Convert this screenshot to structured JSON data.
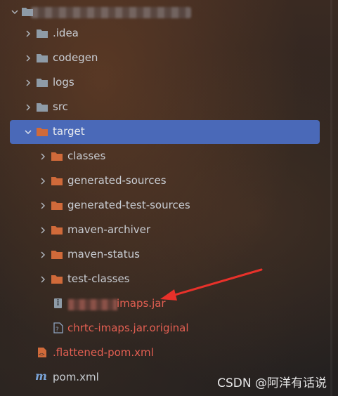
{
  "tree": {
    "items": [
      {
        "label": ".idea",
        "type": "folder",
        "expanded": false
      },
      {
        "label": "codegen",
        "type": "folder",
        "expanded": false
      },
      {
        "label": "logs",
        "type": "folder",
        "expanded": false
      },
      {
        "label": "src",
        "type": "folder",
        "expanded": false
      },
      {
        "label": "target",
        "type": "folder",
        "expanded": true,
        "selected": true
      },
      {
        "label": "classes",
        "type": "folder",
        "expanded": false
      },
      {
        "label": "generated-sources",
        "type": "folder",
        "expanded": false
      },
      {
        "label": "generated-test-sources",
        "type": "folder",
        "expanded": false
      },
      {
        "label": "maven-archiver",
        "type": "folder",
        "expanded": false
      },
      {
        "label": "maven-status",
        "type": "folder",
        "expanded": false
      },
      {
        "label": "test-classes",
        "type": "folder",
        "expanded": false
      },
      {
        "label": "imaps.jar",
        "type": "jar-file"
      },
      {
        "label": "chrtc-imaps.jar.original",
        "type": "original-file"
      },
      {
        "label": ".flattened-pom.xml",
        "type": "xml-file"
      },
      {
        "label": "pom.xml",
        "type": "maven-file"
      }
    ]
  },
  "colors": {
    "selection": "#4a69b8",
    "folder_orange": "#d06a3a",
    "folder_grey": "#8e9ba7",
    "text": "#c9cdd3",
    "red_text": "#e35f52",
    "arrow": "#e8312a"
  },
  "watermark": "CSDN @阿洋有话说"
}
